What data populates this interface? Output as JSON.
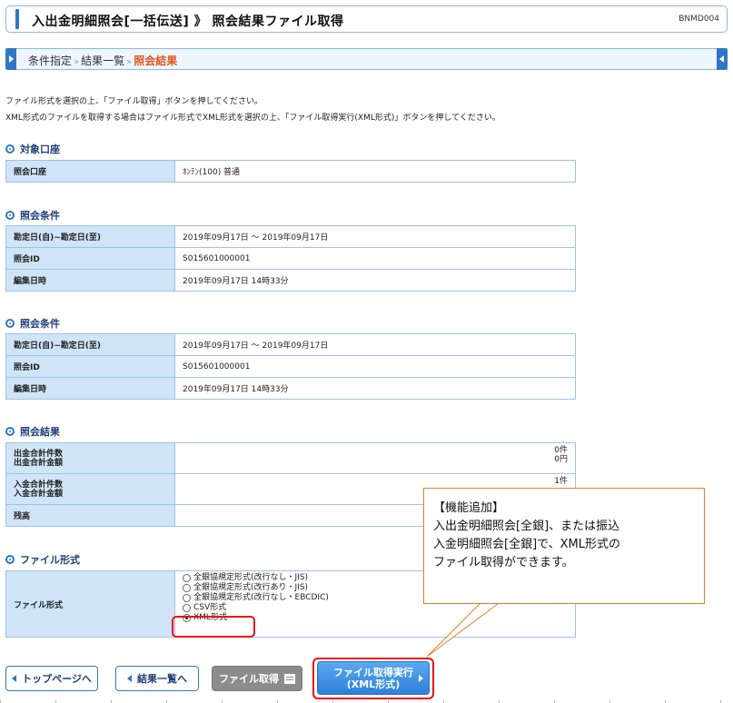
{
  "header": {
    "title": "入出金明細照会[一括伝送] 》 照会結果ファイル取得",
    "screen_id": "BNMD004"
  },
  "breadcrumb": {
    "steps": [
      "条件指定",
      "結果一覧",
      "照会結果"
    ],
    "separator": "»"
  },
  "instructions": [
    "ファイル形式を選択の上、「ファイル取得」ボタンを押してください。",
    "XML形式のファイルを取得する場合はファイル形式でXML形式を選択の上、「ファイル取得実行(XML形式)」ボタンを押してください。"
  ],
  "account_section": {
    "title": "対象口座",
    "label": "照会口座",
    "value": "ﾎﾝﾃﾝ(100) 普通"
  },
  "condition_section_1": {
    "title": "照会条件",
    "rows": [
      {
        "label": "勘定日(自)~勘定日(至)",
        "value": "2019年09月17日 ～ 2019年09月17日"
      },
      {
        "label": "照会ID",
        "value": "S015601000001"
      },
      {
        "label": "編集日時",
        "value": "2019年09月17日 14時33分"
      }
    ]
  },
  "condition_section_2": {
    "title": "照会条件",
    "rows": [
      {
        "label": "勘定日(自)~勘定日(至)",
        "value": "2019年09月17日 ～ 2019年09月17日"
      },
      {
        "label": "照会ID",
        "value": "S015601000001"
      },
      {
        "label": "編集日時",
        "value": "2019年09月17日 14時33分"
      }
    ]
  },
  "result_section": {
    "title": "照会結果",
    "rows": [
      {
        "label1": "出金合計件数",
        "label2": "出金合計金額",
        "value1": "0件",
        "value2": "0円"
      },
      {
        "label1": "入金合計件数",
        "label2": "入金合計金額",
        "value1": "1件",
        "value2": ""
      },
      {
        "label1": "残高",
        "label2": "",
        "value1": "",
        "value2": ""
      }
    ]
  },
  "file_section": {
    "title": "ファイル形式",
    "label": "ファイル形式",
    "options": [
      "全銀協規定形式(改行なし・JIS)",
      "全銀協規定形式(改行あり・JIS)",
      "全銀協規定形式(改行なし・EBCDIC)",
      "CSV形式",
      "XML形式"
    ],
    "selected_index": 4
  },
  "callout": {
    "title": "【機能追加】",
    "lines": [
      "入出金明細照会[全銀]、または振込",
      "入金明細照会[全銀]で、XML形式の",
      "ファイル取得ができます。"
    ]
  },
  "buttons": {
    "top_page": "トップページへ",
    "result_list": "結果一覧へ",
    "get_file": "ファイル取得",
    "get_xml_line1": "ファイル取得実行",
    "get_xml_line2": "(XML形式)"
  },
  "colors": {
    "accent": "#2f77c4",
    "current_step": "#e2531d",
    "highlight": "#ee1111",
    "callout_border": "#e0802a"
  }
}
